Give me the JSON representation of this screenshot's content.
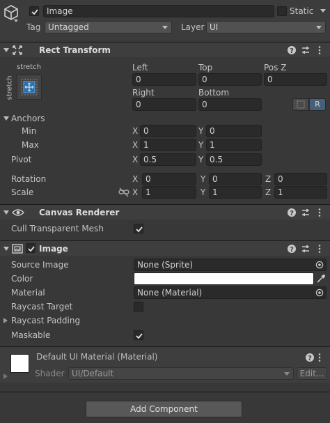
{
  "header": {
    "name_value": "Image",
    "active_checked": true,
    "static_label": "Static",
    "tag_label": "Tag",
    "tag_value": "Untagged",
    "layer_label": "Layer",
    "layer_value": "UI"
  },
  "rect_transform": {
    "title": "Rect Transform",
    "anchor_preset_h": "stretch",
    "anchor_preset_v": "stretch",
    "left_label": "Left",
    "left_value": "0",
    "top_label": "Top",
    "top_value": "0",
    "posz_label": "Pos Z",
    "posz_value": "0",
    "right_label": "Right",
    "right_value": "0",
    "bottom_label": "Bottom",
    "bottom_value": "0",
    "raw_button": "R",
    "anchors_label": "Anchors",
    "min_label": "Min",
    "min_x": "0",
    "min_y": "0",
    "max_label": "Max",
    "max_x": "1",
    "max_y": "1",
    "pivot_label": "Pivot",
    "pivot_x": "0.5",
    "pivot_y": "0.5",
    "rotation_label": "Rotation",
    "rot_x": "0",
    "rot_y": "0",
    "rot_z": "0",
    "scale_label": "Scale",
    "scale_x": "1",
    "scale_y": "1",
    "scale_z": "1",
    "axis_x": "X",
    "axis_y": "Y",
    "axis_z": "Z"
  },
  "canvas_renderer": {
    "title": "Canvas Renderer",
    "cull_label": "Cull Transparent Mesh",
    "cull_checked": true
  },
  "image": {
    "title": "Image",
    "enabled": true,
    "source_label": "Source Image",
    "source_value": "None (Sprite)",
    "color_label": "Color",
    "color_value": "#ffffff",
    "material_label": "Material",
    "material_value": "None (Material)",
    "raycast_target_label": "Raycast Target",
    "raycast_target_checked": false,
    "raycast_padding_label": "Raycast Padding",
    "maskable_label": "Maskable",
    "maskable_checked": true
  },
  "material": {
    "title": "Default UI Material (Material)",
    "shader_label": "Shader",
    "shader_value": "UI/Default",
    "edit_button": "Edit..."
  },
  "footer": {
    "add_component": "Add Component"
  },
  "icons": {
    "help": "help-icon",
    "presets": "presets-icon",
    "menu": "kebab-menu-icon"
  }
}
